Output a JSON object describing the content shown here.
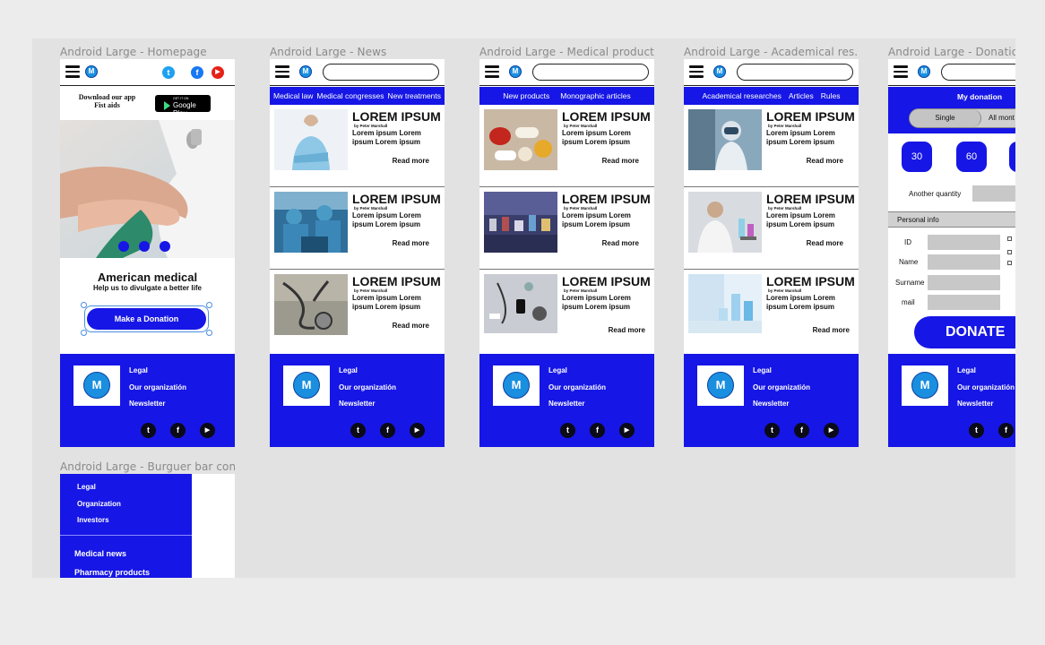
{
  "frames": {
    "home": "Android Large - Homepage",
    "news": "Android Large - News",
    "medical": "Android Large - Medical products",
    "academic": "Android Large - Academical res...",
    "donation": "Android Large - Donation",
    "burger": "Android Large - Burguer bar con..."
  },
  "home": {
    "download": "Download our app",
    "first_aids": "Fist aids",
    "gp_small": "GET IT ON",
    "gp": "Google Play",
    "heading": "American medical",
    "subheading": "Help us to divulgate a better life",
    "donate_button": "Make a Donation"
  },
  "logo": "M",
  "social": {
    "twitter": "t",
    "facebook": "f",
    "youtube": "▶"
  },
  "article": {
    "title": "LOREM IPSUM",
    "author": "by Peter Marshall",
    "text": "Lorem ipsum Lorem ipsum Lorem ipsum",
    "more": "Read more"
  },
  "news_tabs": [
    "Medical law",
    "Medical congresses",
    "New treatments"
  ],
  "medical_tabs": [
    "New products",
    "Monographic articles"
  ],
  "academic_tabs": [
    "Academical researches",
    "Articles",
    "Rules"
  ],
  "footer": {
    "legal": "Legal",
    "org": "Our organizatión",
    "news": "Newsletter"
  },
  "donation": {
    "header": "My donation",
    "single": "Single",
    "monthly": "All mont",
    "amounts": [
      "30",
      "60"
    ],
    "another": "Another quantity",
    "personal": "Personal info",
    "id": "ID",
    "name": "Name",
    "surname": "Surname",
    "mail": "mail",
    "donate": "DONATE"
  },
  "burger": {
    "items": [
      "Legal",
      "Organization",
      "Investors"
    ],
    "items2": [
      "Medical news",
      "Pharmacy products"
    ]
  },
  "colors": {
    "brand": "#1616e6",
    "logo": "#1a8fe0"
  }
}
